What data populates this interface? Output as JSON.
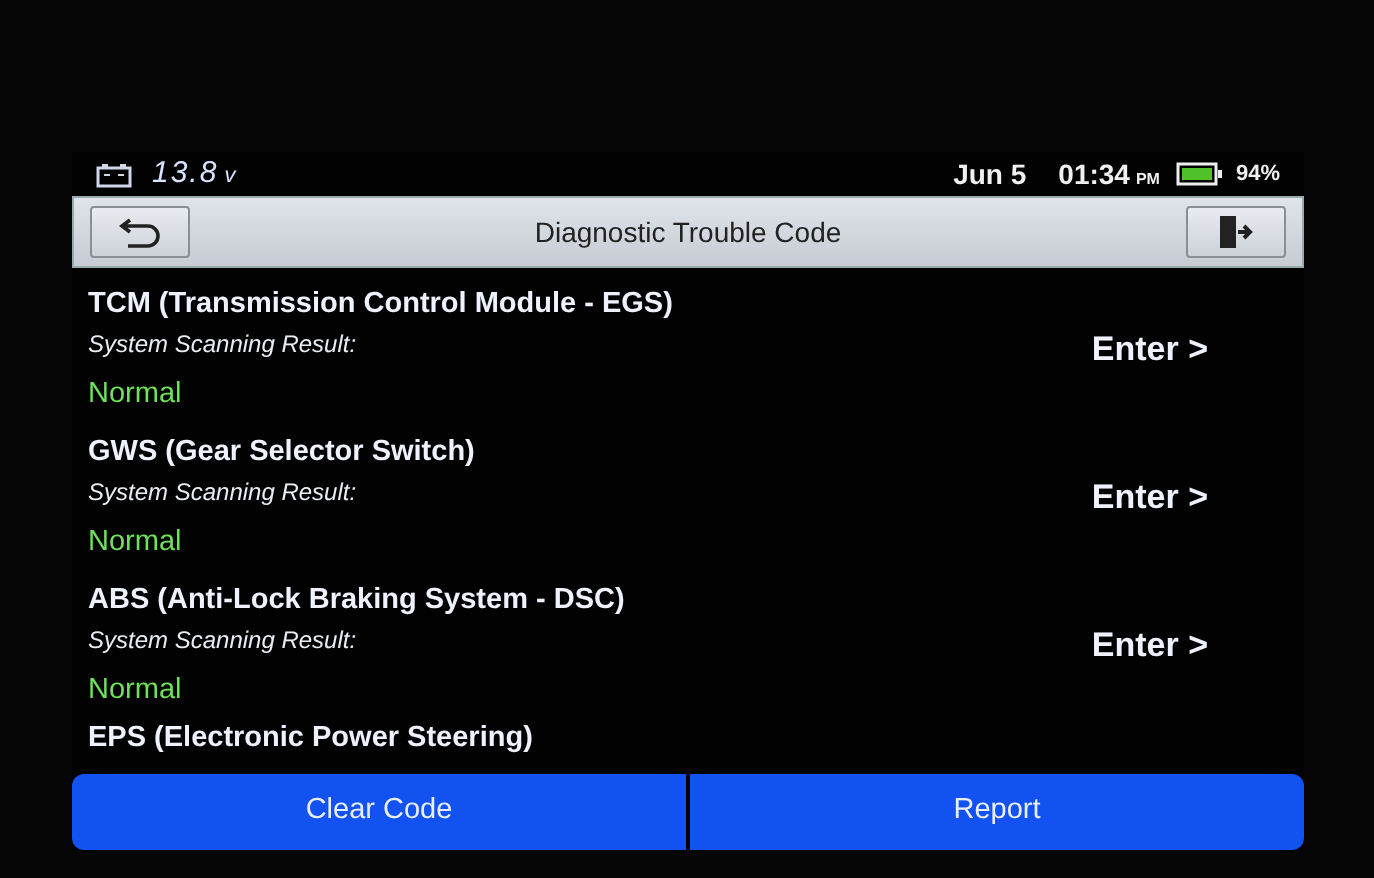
{
  "status_bar": {
    "voltage": "13.8",
    "voltage_unit": "v",
    "date": "Jun 5",
    "time": "01:34",
    "meridiem": "PM",
    "battery": "94%"
  },
  "header": {
    "title": "Diagnostic Trouble Code"
  },
  "systems": [
    {
      "title": "TCM (Transmission Control Module - EGS)",
      "subtitle": "System Scanning Result:",
      "result": "Normal",
      "action": "Enter >"
    },
    {
      "title": "GWS (Gear Selector Switch)",
      "subtitle": "System Scanning Result:",
      "result": "Normal",
      "action": "Enter >"
    },
    {
      "title": "ABS (Anti-Lock Braking System - DSC)",
      "subtitle": "System Scanning Result:",
      "result": "Normal",
      "action": "Enter >"
    },
    {
      "title": "EPS (Electronic Power Steering)"
    }
  ],
  "buttons": [
    "Clear Code",
    "Report"
  ]
}
